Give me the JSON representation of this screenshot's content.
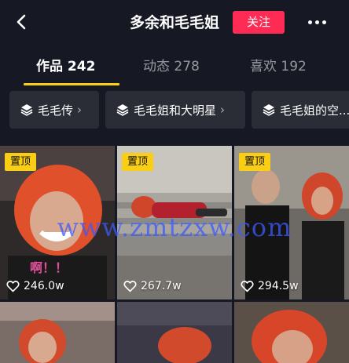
{
  "header": {
    "title": "多余和毛毛姐",
    "follow_label": "关注"
  },
  "tabs": [
    {
      "label": "作品 242",
      "active": true
    },
    {
      "label": "动态 278",
      "active": false
    },
    {
      "label": "喜欢 192",
      "active": false
    }
  ],
  "collections": [
    {
      "label": "毛毛传"
    },
    {
      "label": "毛毛姐和大明星"
    },
    {
      "label": "毛毛姐的空..."
    }
  ],
  "videos": [
    {
      "pinned_label": "置顶",
      "likes": "246.0w",
      "caption": "啊！！"
    },
    {
      "pinned_label": "置顶",
      "likes": "267.7w"
    },
    {
      "pinned_label": "置顶",
      "likes": "294.5w"
    },
    {},
    {},
    {}
  ],
  "watermark": "www.zmtzxw.com",
  "colors": {
    "background": "#161823",
    "follow_button": "#fe2c55",
    "tab_indicator": "#face15",
    "pinned_badge": "#face15",
    "chip_background": "#2a2c36"
  }
}
